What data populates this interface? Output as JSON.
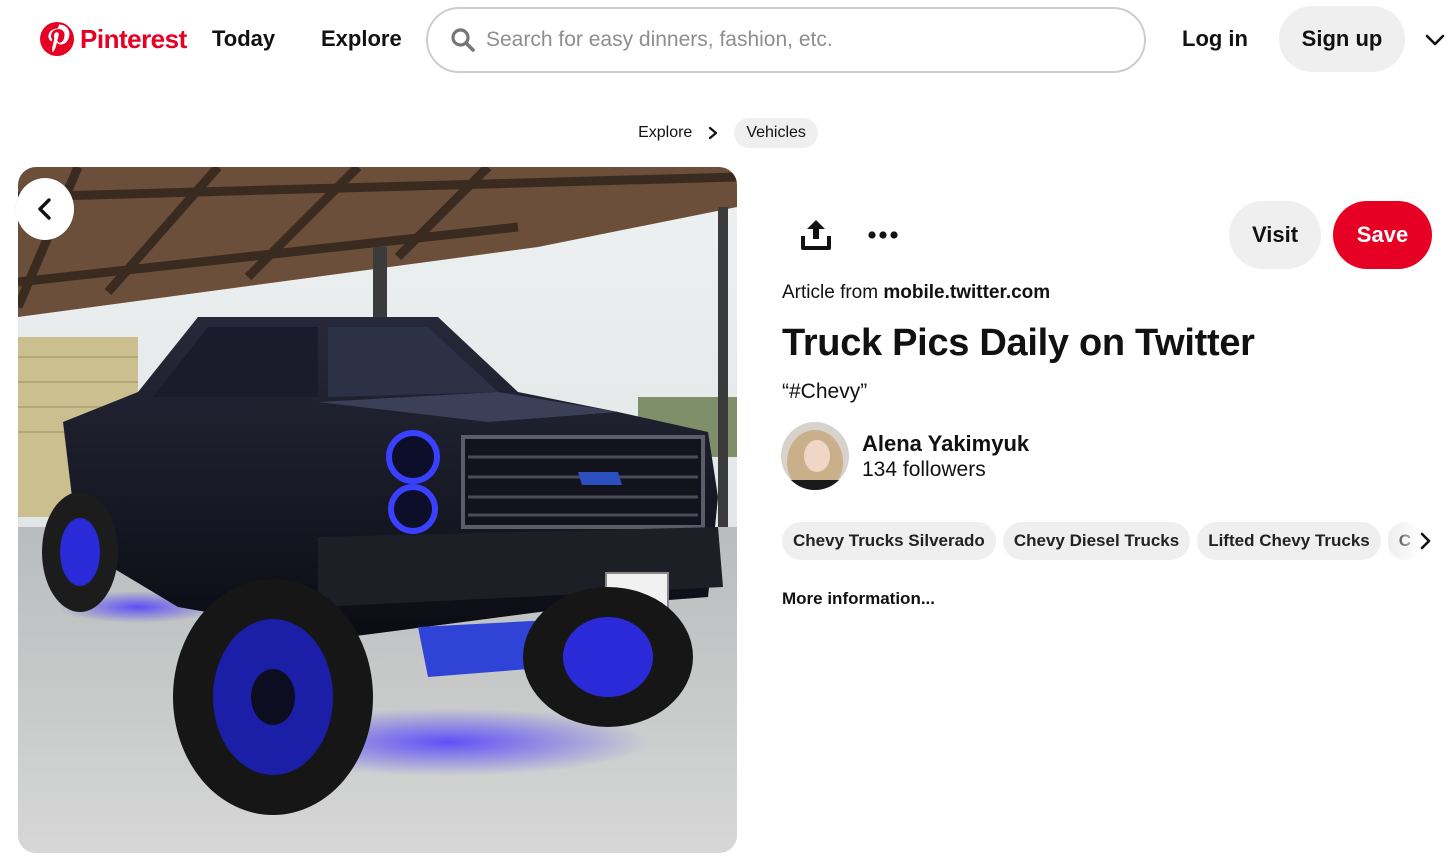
{
  "brand": {
    "name": "Pinterest",
    "color": "#e60023"
  },
  "header": {
    "nav": {
      "today": "Today",
      "explore": "Explore"
    },
    "search": {
      "placeholder": "Search for easy dinners, fashion, etc.",
      "value": ""
    },
    "login": "Log in",
    "signup": "Sign up",
    "icons": [
      "pinterest-logo-icon",
      "search-icon",
      "chevron-down-icon"
    ]
  },
  "breadcrumb": {
    "parent": "Explore",
    "current": "Vehicles"
  },
  "pin": {
    "image_subject": "lifted black Chevy truck with blue lights",
    "actions": {
      "visit": "Visit",
      "save": "Save"
    },
    "source_prefix": "Article from",
    "source_domain": "mobile.twitter.com",
    "title": "Truck Pics Daily on Twitter",
    "description": "“#Chevy”",
    "creator": {
      "name": "Alena Yakimyuk",
      "followers": "134 followers"
    },
    "tags": [
      "Chevy Trucks Silverado",
      "Chevy Diesel Trucks",
      "Lifted Chevy Trucks",
      "C"
    ],
    "more_info": "More information..."
  }
}
